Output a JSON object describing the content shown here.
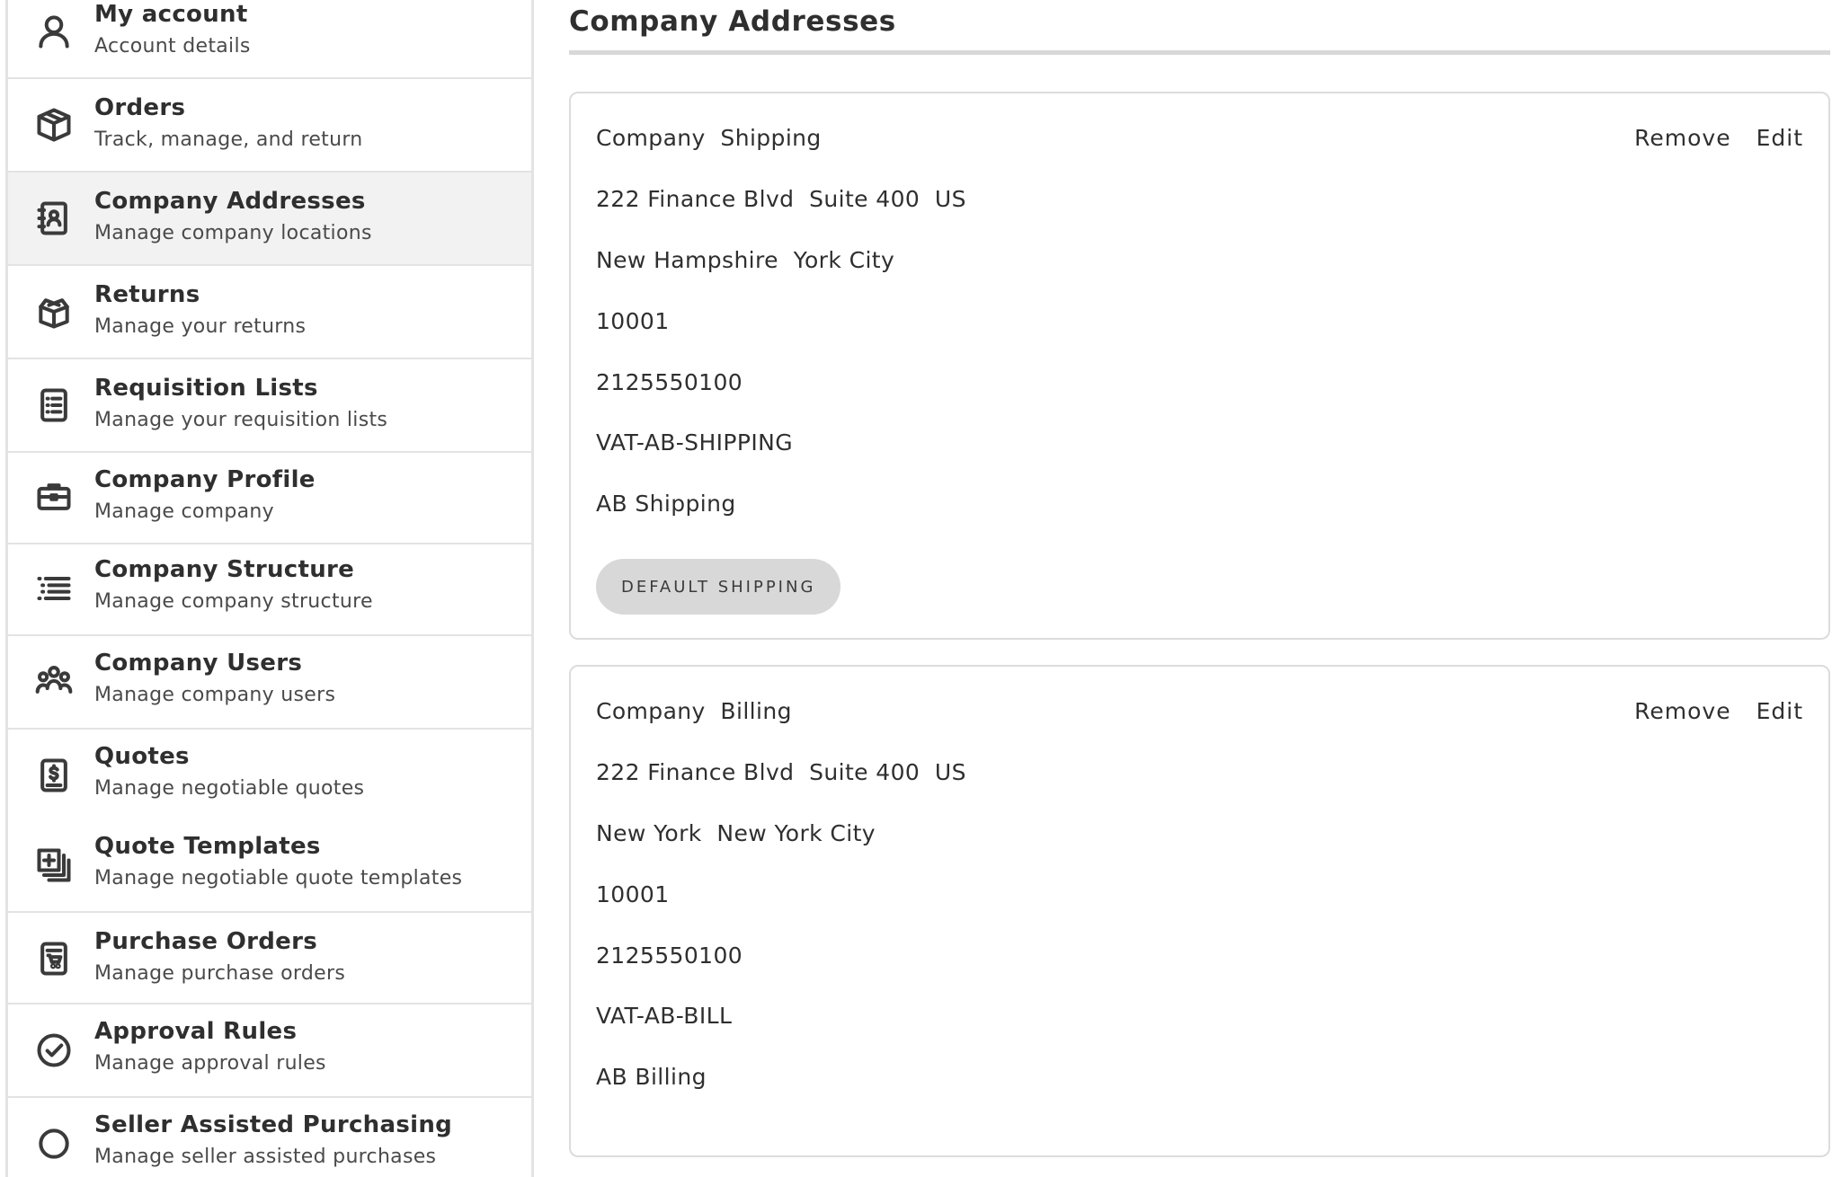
{
  "sidebar": {
    "items": [
      {
        "title": "My account",
        "subtitle": "Account details",
        "icon": "user-icon"
      },
      {
        "title": "Orders",
        "subtitle": "Track, manage, and return",
        "icon": "box-icon"
      },
      {
        "title": "Company Addresses",
        "subtitle": "Manage company locations",
        "icon": "address-book-icon",
        "active": true
      },
      {
        "title": "Returns",
        "subtitle": "Manage your returns",
        "icon": "open-box-icon"
      },
      {
        "title": "Requisition Lists",
        "subtitle": "Manage your requisition lists",
        "icon": "list-icon"
      },
      {
        "title": "Company Profile",
        "subtitle": "Manage company",
        "icon": "briefcase-icon"
      },
      {
        "title": "Company Structure",
        "subtitle": "Manage company structure",
        "icon": "structure-icon"
      },
      {
        "title": "Company Users",
        "subtitle": "Manage company users",
        "icon": "users-icon"
      },
      {
        "title": "Quotes",
        "subtitle": "Manage negotiable quotes",
        "icon": "quote-icon"
      },
      {
        "title": "Quote Templates",
        "subtitle": "Manage negotiable quote templates",
        "icon": "quote-templates-icon"
      },
      {
        "title": "Purchase Orders",
        "subtitle": "Manage purchase orders",
        "icon": "purchase-order-icon"
      },
      {
        "title": "Approval Rules",
        "subtitle": "Manage approval rules",
        "icon": "check-circle-icon"
      },
      {
        "title": "Seller Assisted Purchasing",
        "subtitle": "Manage seller assisted purchases",
        "icon": "circle-icon"
      }
    ]
  },
  "main": {
    "title": "Company Addresses",
    "cards": [
      {
        "name": "Company  Shipping",
        "remove_label": "Remove",
        "edit_label": "Edit",
        "lines": [
          "222 Finance Blvd  Suite 400  US",
          "New Hampshire  York City",
          "10001",
          "2125550100",
          "VAT-AB-SHIPPING",
          "AB Shipping"
        ],
        "badge": "DEFAULT SHIPPING"
      },
      {
        "name": "Company  Billing",
        "remove_label": "Remove",
        "edit_label": "Edit",
        "lines": [
          "222 Finance Blvd  Suite 400  US",
          "New York  New York City",
          "10001",
          "2125550100",
          "VAT-AB-BILL",
          "AB Billing"
        ]
      }
    ]
  },
  "colors": {
    "active_item_bg": "#f2f2f2",
    "badge_bg": "#d8d8d8",
    "border": "#dcdcdc"
  }
}
